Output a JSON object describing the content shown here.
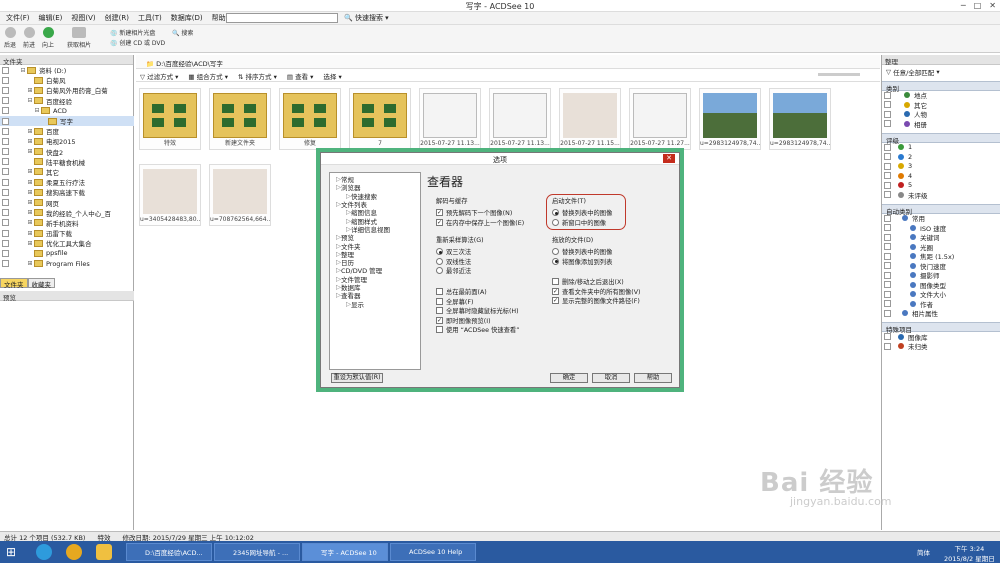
{
  "window": {
    "title": "写字 - ACDSee 10"
  },
  "menu": [
    "文件(F)",
    "编辑(E)",
    "视图(V)",
    "创建(R)",
    "工具(T)",
    "数据库(D)",
    "帮助(H)"
  ],
  "quick_search": "快速搜索",
  "toolbar": {
    "back": "后退",
    "forward": "前进",
    "up": "向上",
    "acquire": "获取相片",
    "create_photo_cd": "新建相片光盘",
    "create_cd_dvd": "创建 CD 或 DVD",
    "search": "搜索"
  },
  "left": {
    "header": "文件夹",
    "tree": [
      {
        "label": "资料 (D:)",
        "indent": 2,
        "expander": "⊟"
      },
      {
        "label": "白菊风",
        "indent": 3,
        "expander": ""
      },
      {
        "label": "白菊风外用药膏_白菊",
        "indent": 3,
        "expander": "⊞"
      },
      {
        "label": "百度经验",
        "indent": 3,
        "expander": "⊟"
      },
      {
        "label": "ACD",
        "indent": 4,
        "expander": "⊟"
      },
      {
        "label": "写字",
        "indent": 5,
        "expander": "",
        "selected": true
      },
      {
        "label": "百度",
        "indent": 3,
        "expander": "⊞"
      },
      {
        "label": "电视2015",
        "indent": 3,
        "expander": "⊞"
      },
      {
        "label": "快盘2",
        "indent": 3,
        "expander": "⊞"
      },
      {
        "label": "陆平糖食机械",
        "indent": 3,
        "expander": ""
      },
      {
        "label": "其它",
        "indent": 3,
        "expander": "⊞"
      },
      {
        "label": "柔夏五行疗法",
        "indent": 3,
        "expander": "⊞"
      },
      {
        "label": "搜狗高速下载",
        "indent": 3,
        "expander": "⊞"
      },
      {
        "label": "网页",
        "indent": 3,
        "expander": "⊞"
      },
      {
        "label": "我的经验_个人中心_百",
        "indent": 3,
        "expander": "⊞"
      },
      {
        "label": "新手机资料",
        "indent": 3,
        "expander": "⊞"
      },
      {
        "label": "迅雷下载",
        "indent": 3,
        "expander": "⊞"
      },
      {
        "label": "优化工具大集合",
        "indent": 3,
        "expander": "⊞"
      },
      {
        "label": "ppsfile",
        "indent": 3,
        "expander": ""
      },
      {
        "label": "Program Files",
        "indent": 3,
        "expander": "⊞"
      }
    ],
    "tabs": [
      "文件夹",
      "收藏夹"
    ],
    "preview_header": "预览"
  },
  "main": {
    "path": "D:\\百度经验\\ACD\\写字",
    "filters": [
      "过滤方式",
      "组合方式",
      "排序方式",
      "查看",
      "选择"
    ],
    "thumbs": [
      {
        "caption": "特效",
        "kind": "folder"
      },
      {
        "caption": "新建文件夹",
        "kind": "folder"
      },
      {
        "caption": "修复",
        "kind": "folder"
      },
      {
        "caption": "7",
        "kind": "folder"
      },
      {
        "caption": "2015-07-27 11.13...",
        "kind": "doc"
      },
      {
        "caption": "2015-07-27 11.13...",
        "kind": "doc"
      },
      {
        "caption": "2015-07-27 11.15...",
        "kind": "photo"
      },
      {
        "caption": "2015-07-27 11.27...",
        "kind": "doc"
      },
      {
        "caption": "u=2983124978,74...",
        "kind": "scene"
      },
      {
        "caption": "u=2983124978,74...",
        "kind": "scene"
      },
      {
        "caption": "u=3405428483,80...",
        "kind": "photo"
      },
      {
        "caption": "u=708762564,664...",
        "kind": "photo"
      }
    ]
  },
  "right": {
    "header": "整理",
    "dropdown": "任意/全部匹配",
    "categories_title": "类别",
    "categories": [
      "地点",
      "其它",
      "人物",
      "相册"
    ],
    "ratings_title": "评级",
    "ratings": [
      "1",
      "2",
      "3",
      "4",
      "5",
      "未评级"
    ],
    "auto_title": "自动类别",
    "auto_items": [
      "常用",
      "ISO 速度",
      "关键词",
      "光圈",
      "焦距 (1.5x)",
      "快门速度",
      "摄影师",
      "图像类型",
      "文件大小",
      "作者",
      "相片属性"
    ],
    "special_title": "特殊项目",
    "special": [
      "图像库",
      "未归类"
    ],
    "colors": {
      "c1": "#3a9a3a",
      "c2": "#2a7ad0",
      "c3": "#d8a800",
      "c4": "#e07a00",
      "c5": "#c02020"
    }
  },
  "dialog": {
    "title": "选项",
    "heading": "查看器",
    "tree": [
      {
        "label": "常规",
        "indent": 0
      },
      {
        "label": "浏览器",
        "indent": 0
      },
      {
        "label": "快速搜索",
        "indent": 1
      },
      {
        "label": "文件列表",
        "indent": 0
      },
      {
        "label": "缩图信息",
        "indent": 1
      },
      {
        "label": "缩图样式",
        "indent": 1
      },
      {
        "label": "详细信息视图",
        "indent": 1
      },
      {
        "label": "预览",
        "indent": 0
      },
      {
        "label": "文件夹",
        "indent": 0
      },
      {
        "label": "整理",
        "indent": 0
      },
      {
        "label": "日历",
        "indent": 0
      },
      {
        "label": "CD/DVD 管理",
        "indent": 0
      },
      {
        "label": "文件管理",
        "indent": 0
      },
      {
        "label": "数据库",
        "indent": 0
      },
      {
        "label": "查看器",
        "indent": 0
      },
      {
        "label": "显示",
        "indent": 1
      }
    ],
    "decode": {
      "label": "解码与缓存",
      "opt1": "预先解码下一个图像(N)",
      "opt2": "在内存中保存上一个图像(E)"
    },
    "startup": {
      "label": "启动文件(T)",
      "opt1": "替换列表中的图像",
      "opt2": "新窗口中的图像"
    },
    "resample": {
      "label": "重新采样算法(G)",
      "opt1": "双三次法",
      "opt2": "双线性法",
      "opt3": "最邻近法"
    },
    "dragged": {
      "label": "拖放的文件(D)",
      "opt1": "替换列表中的图像",
      "opt2": "将图像添加到列表"
    },
    "checks_left": [
      {
        "label": "总在最前面(A)",
        "checked": false
      },
      {
        "label": "全屏幕(F)",
        "checked": false
      },
      {
        "label": "全屏幕时隐藏鼠标光标(H)",
        "checked": false
      },
      {
        "label": "即时图像预览(I)",
        "checked": true
      },
      {
        "label": "使用 “ACDSee 快速查看”",
        "checked": false
      }
    ],
    "checks_right": [
      {
        "label": "删除/移动之后退出(X)",
        "checked": false
      },
      {
        "label": "查看文件夹中的所有图像(V)",
        "checked": true
      },
      {
        "label": "显示完整的图像文件路径(F)",
        "checked": true
      }
    ],
    "reset": "重设为默认值(R)",
    "ok": "确定",
    "cancel": "取消",
    "help": "帮助"
  },
  "status": {
    "total": "总计 12 个项目 (532.7 KB)",
    "selected_item": "特效",
    "modified": "修改日期: 2015/7/29 星期三 上午 10:12:02"
  },
  "taskbar": {
    "items": [
      "D:\\百度经验\\ACD...",
      "2345网址导航 - ...",
      "写字 - ACDSee 10",
      "ACDSee 10 Help"
    ],
    "ime": "简体",
    "time": "下午 3:24",
    "date": "2015/8/2 星期日"
  },
  "watermark": {
    "brand": "Bai 经验",
    "url": "jingyan.baidu.com"
  }
}
